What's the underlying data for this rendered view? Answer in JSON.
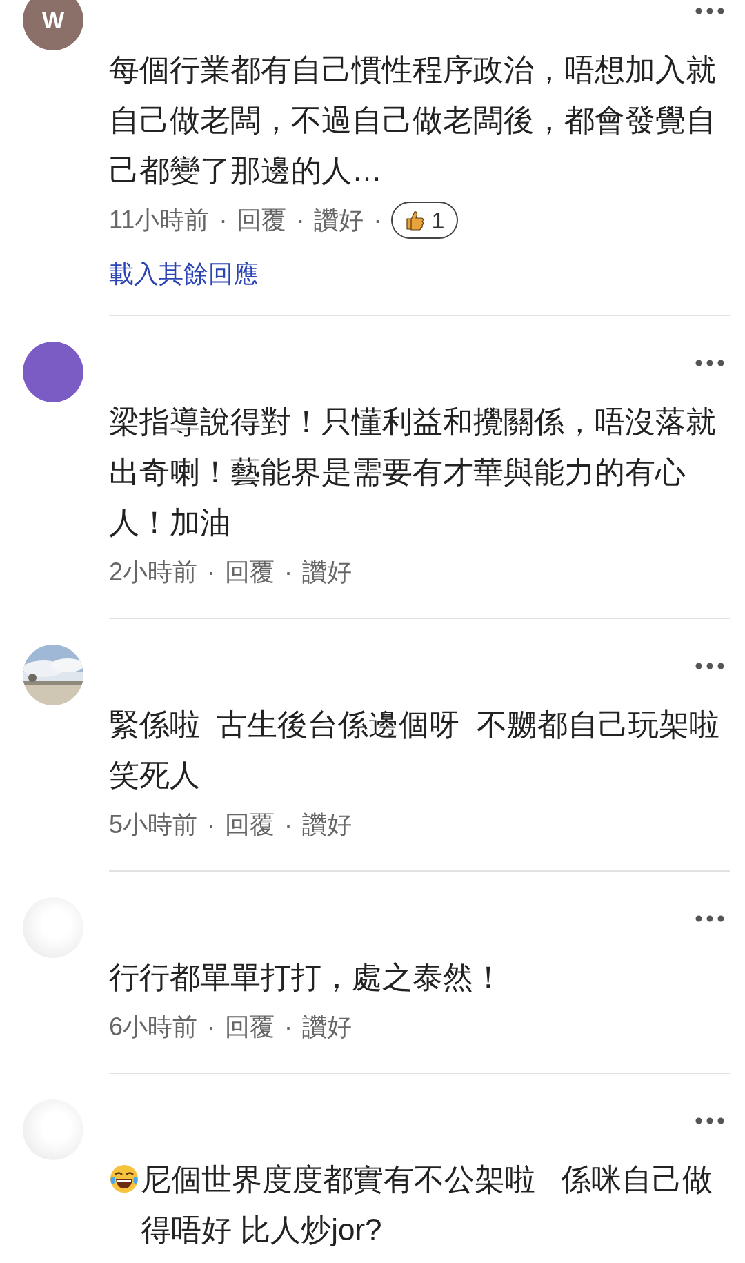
{
  "comments": [
    {
      "avatar": {
        "kind": "letter",
        "letter": "W",
        "color": "#8a7068"
      },
      "text": "每個行業都有自己慣性程序政治，唔想加入就自己做老闆，不過自己做老闆後，都會發覺自己都變了那邊的人…",
      "meta": [
        {
          "kind": "time",
          "text": "11小時前"
        },
        {
          "kind": "separator",
          "text": "·"
        },
        {
          "kind": "action",
          "text": "回覆"
        },
        {
          "kind": "separator",
          "text": "·"
        },
        {
          "kind": "action",
          "text": "讚好"
        },
        {
          "kind": "separator",
          "text": "·"
        },
        {
          "kind": "reaction",
          "text": "1"
        }
      ],
      "more_replies": "載入其餘回應"
    },
    {
      "avatar": {
        "kind": "letter",
        "color": "#7b5cc4"
      },
      "text": "梁指導說得對！只懂利益和攪關係，唔沒落就出奇喇！藝能界是需要有才華與能力的有心人！加油",
      "meta": [
        {
          "kind": "time",
          "text": "2小時前"
        },
        {
          "kind": "separator",
          "text": "·"
        },
        {
          "kind": "action",
          "text": "回覆"
        },
        {
          "kind": "separator",
          "text": "·"
        },
        {
          "kind": "action",
          "text": "讚好"
        }
      ]
    },
    {
      "text": "緊係啦  古生後台係邊個呀  不嬲都自己玩架啦笑死人",
      "meta": [
        {
          "kind": "time",
          "text": "5小時前"
        },
        {
          "kind": "separator",
          "text": "·"
        },
        {
          "kind": "action",
          "text": "回覆"
        },
        {
          "kind": "separator",
          "text": "·"
        },
        {
          "kind": "action",
          "text": "讚好"
        }
      ]
    },
    {
      "avatar": {
        "kind": "blank"
      },
      "text": "行行都單單打打，處之泰然！",
      "meta": [
        {
          "kind": "time",
          "text": "6小時前"
        },
        {
          "kind": "separator",
          "text": "·"
        },
        {
          "kind": "action",
          "text": "回覆"
        },
        {
          "kind": "separator",
          "text": "·"
        },
        {
          "kind": "action",
          "text": "讚好"
        }
      ]
    },
    {
      "avatar": {
        "kind": "blank"
      },
      "emoji": true,
      "text": "尼個世界度度都實有不公架啦   係咪自己做得唔好 比人炒jor?"
    }
  ]
}
